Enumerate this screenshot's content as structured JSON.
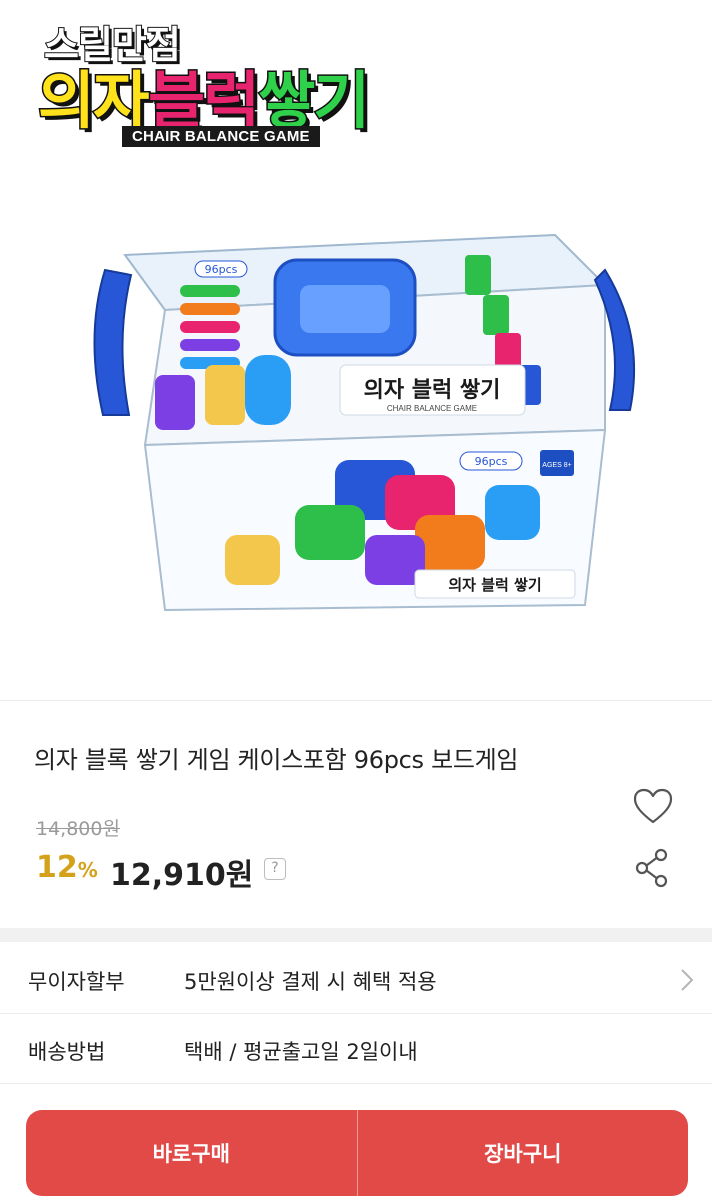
{
  "hero": {
    "brand_sub": "스릴만점",
    "brand_main_1": "의자",
    "brand_main_2": "블럭",
    "brand_main_3": "쌓기",
    "brand_en": "CHAIR BALANCE GAME",
    "box_tag_left": "96pcs",
    "box_tag_right": "96pcs",
    "box_label_front": "의자 블럭 쌓기",
    "box_label_front_en": "CHAIR BALANCE GAME",
    "box_ages": "AGES 8+"
  },
  "product": {
    "title": "의자 블록 쌓기 게임 케이스포함 96pcs 보드게임",
    "original_price": "14,800원",
    "discount_value": "12",
    "discount_unit": "%",
    "price": "12,910원",
    "price_help": "?"
  },
  "info_rows": [
    {
      "label": "무이자할부",
      "value": "5만원이상 결제 시 혜택 적용"
    },
    {
      "label": "배송방법",
      "value": "택배 / 평균출고일 2일이내"
    }
  ],
  "actions": {
    "buy_now": "바로구매",
    "cart": "장바구니"
  },
  "colors": {
    "accent": "#e24a48",
    "discount": "#d4a21a",
    "box_handle": "#2757d6"
  },
  "icons": {
    "wishlist": "heart-icon",
    "share": "share-icon",
    "row_arrow": "chevron-right-icon",
    "help": "question-icon"
  }
}
